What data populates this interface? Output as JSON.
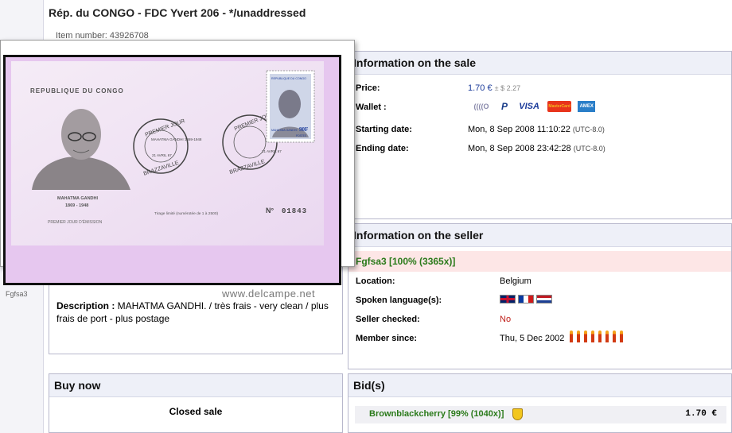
{
  "title": "Rép. du CONGO - FDC Yvert 206 - */unaddressed",
  "item_number": "Item number: 43926708",
  "popup": {
    "seller_tag": "Fgfsa3",
    "watermark": "www.delcampe.net"
  },
  "description": {
    "label": "Description :",
    "text": " MAHATMA GANDHI. / très frais - very clean / plus frais de port - plus postage"
  },
  "sale": {
    "heading": "Information on the sale",
    "price_label": "Price:",
    "price_value": "1.70 €",
    "price_usd": "± $ 2.27",
    "wallet_label": "Wallet :",
    "wallet_icons": [
      "moneybookers-icon",
      "paypal-icon",
      "visa-icon",
      "mastercard-icon",
      "amex-icon"
    ],
    "wallet_icon_text": {
      "moneybookers": "((((O",
      "paypal": "P",
      "visa": "VISA",
      "mastercard": "MasterCard",
      "amex": "AMEX"
    },
    "start_label": "Starting date:",
    "start_value": "Mon, 8 Sep 2008 11:10:22",
    "start_tz": "(UTC-8.0)",
    "end_label": "Ending date:",
    "end_value": "Mon, 8 Sep 2008 23:42:28",
    "end_tz": "(UTC-8.0)"
  },
  "seller": {
    "heading": "Information on the seller",
    "name": "Fgfsa3 [100% (3365x)]",
    "location_label": "Location:",
    "location_value": "Belgium",
    "languages_label": "Spoken language(s):",
    "seller_checked_label": "Seller checked:",
    "seller_checked_value": "No",
    "member_since_label": "Member since:",
    "member_since_value": "Thu, 5 Dec 2002",
    "rating_icon_count": 8
  },
  "buy_now": {
    "heading": "Buy now",
    "status": "Closed sale"
  },
  "bids": {
    "heading": "Bid(s)",
    "rows": [
      {
        "bidder": "Brownblackcherry [99% (1040x)]",
        "amount": "1.70 €"
      }
    ]
  },
  "cover": {
    "country": "REPUBLIQUE DU CONGO",
    "postmark_left": "PREMIER JOUR",
    "postmark_mid": "MAHATMA GANDHI 1869-1948",
    "postmark_date": "21 AVRIL 67",
    "postmark_city": "BRAZZAVILLE",
    "stamp_top": "REPUBLIQUE DU CONGO",
    "stamp_name": "MAHATMA GANDHI",
    "stamp_value": "90F",
    "stamp_bottom": "POSTES",
    "portrait_name": "MAHATMA GANDHI",
    "portrait_years": "1869 - 1948",
    "first_day": "PREMIER JOUR D'ÉMISSION",
    "limited": "Tirage limité (numérotée de 1 à 2500)",
    "number_label": "N°",
    "number": "01843"
  },
  "colors": {
    "accent_blue": "#1a3a9a",
    "seller_green": "#2a7a1a",
    "panel_head": "#eef0f8",
    "no_red": "#c0201a"
  }
}
